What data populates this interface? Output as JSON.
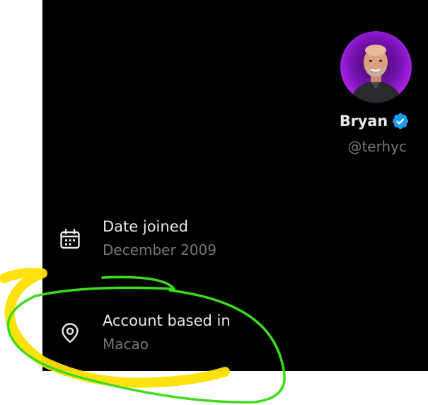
{
  "profile": {
    "name": "Bryan",
    "handle": "@terhyc",
    "verified": true,
    "verified_color": "#1d9bf0",
    "avatar_ring_color": "#a020f0"
  },
  "details": [
    {
      "icon": "calendar-icon",
      "label": "Date joined",
      "value": "December 2009"
    },
    {
      "icon": "location-pin-icon",
      "label": "Account based in",
      "value": "Macao"
    }
  ],
  "annotations": {
    "highlight_color": "#ffe000",
    "circle_color": "#3ddc1a"
  }
}
